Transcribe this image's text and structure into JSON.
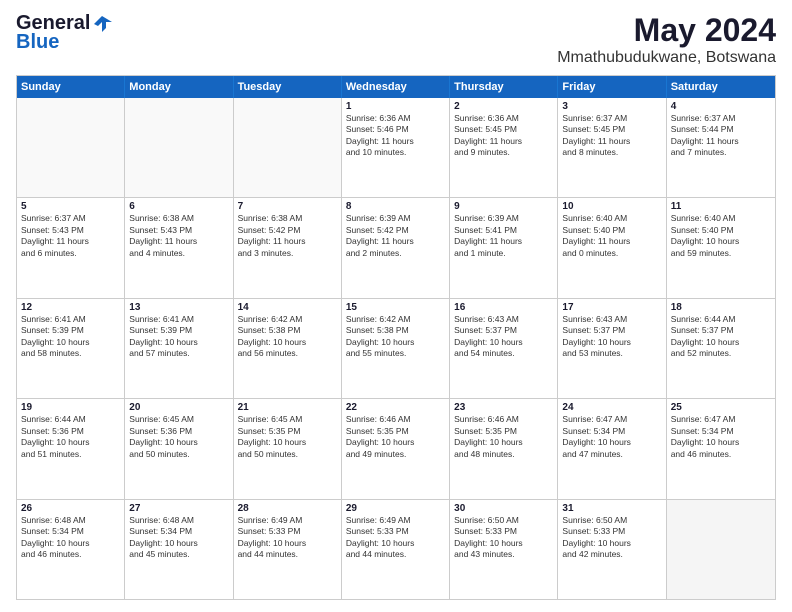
{
  "logo": {
    "line1": "General",
    "line2": "Blue"
  },
  "title": "May 2024",
  "subtitle": "Mmathubudukwane, Botswana",
  "weekdays": [
    "Sunday",
    "Monday",
    "Tuesday",
    "Wednesday",
    "Thursday",
    "Friday",
    "Saturday"
  ],
  "rows": [
    [
      {
        "day": "",
        "content": ""
      },
      {
        "day": "",
        "content": ""
      },
      {
        "day": "",
        "content": ""
      },
      {
        "day": "1",
        "content": "Sunrise: 6:36 AM\nSunset: 5:46 PM\nDaylight: 11 hours\nand 10 minutes."
      },
      {
        "day": "2",
        "content": "Sunrise: 6:36 AM\nSunset: 5:45 PM\nDaylight: 11 hours\nand 9 minutes."
      },
      {
        "day": "3",
        "content": "Sunrise: 6:37 AM\nSunset: 5:45 PM\nDaylight: 11 hours\nand 8 minutes."
      },
      {
        "day": "4",
        "content": "Sunrise: 6:37 AM\nSunset: 5:44 PM\nDaylight: 11 hours\nand 7 minutes."
      }
    ],
    [
      {
        "day": "5",
        "content": "Sunrise: 6:37 AM\nSunset: 5:43 PM\nDaylight: 11 hours\nand 6 minutes."
      },
      {
        "day": "6",
        "content": "Sunrise: 6:38 AM\nSunset: 5:43 PM\nDaylight: 11 hours\nand 4 minutes."
      },
      {
        "day": "7",
        "content": "Sunrise: 6:38 AM\nSunset: 5:42 PM\nDaylight: 11 hours\nand 3 minutes."
      },
      {
        "day": "8",
        "content": "Sunrise: 6:39 AM\nSunset: 5:42 PM\nDaylight: 11 hours\nand 2 minutes."
      },
      {
        "day": "9",
        "content": "Sunrise: 6:39 AM\nSunset: 5:41 PM\nDaylight: 11 hours\nand 1 minute."
      },
      {
        "day": "10",
        "content": "Sunrise: 6:40 AM\nSunset: 5:40 PM\nDaylight: 11 hours\nand 0 minutes."
      },
      {
        "day": "11",
        "content": "Sunrise: 6:40 AM\nSunset: 5:40 PM\nDaylight: 10 hours\nand 59 minutes."
      }
    ],
    [
      {
        "day": "12",
        "content": "Sunrise: 6:41 AM\nSunset: 5:39 PM\nDaylight: 10 hours\nand 58 minutes."
      },
      {
        "day": "13",
        "content": "Sunrise: 6:41 AM\nSunset: 5:39 PM\nDaylight: 10 hours\nand 57 minutes."
      },
      {
        "day": "14",
        "content": "Sunrise: 6:42 AM\nSunset: 5:38 PM\nDaylight: 10 hours\nand 56 minutes."
      },
      {
        "day": "15",
        "content": "Sunrise: 6:42 AM\nSunset: 5:38 PM\nDaylight: 10 hours\nand 55 minutes."
      },
      {
        "day": "16",
        "content": "Sunrise: 6:43 AM\nSunset: 5:37 PM\nDaylight: 10 hours\nand 54 minutes."
      },
      {
        "day": "17",
        "content": "Sunrise: 6:43 AM\nSunset: 5:37 PM\nDaylight: 10 hours\nand 53 minutes."
      },
      {
        "day": "18",
        "content": "Sunrise: 6:44 AM\nSunset: 5:37 PM\nDaylight: 10 hours\nand 52 minutes."
      }
    ],
    [
      {
        "day": "19",
        "content": "Sunrise: 6:44 AM\nSunset: 5:36 PM\nDaylight: 10 hours\nand 51 minutes."
      },
      {
        "day": "20",
        "content": "Sunrise: 6:45 AM\nSunset: 5:36 PM\nDaylight: 10 hours\nand 50 minutes."
      },
      {
        "day": "21",
        "content": "Sunrise: 6:45 AM\nSunset: 5:35 PM\nDaylight: 10 hours\nand 50 minutes."
      },
      {
        "day": "22",
        "content": "Sunrise: 6:46 AM\nSunset: 5:35 PM\nDaylight: 10 hours\nand 49 minutes."
      },
      {
        "day": "23",
        "content": "Sunrise: 6:46 AM\nSunset: 5:35 PM\nDaylight: 10 hours\nand 48 minutes."
      },
      {
        "day": "24",
        "content": "Sunrise: 6:47 AM\nSunset: 5:34 PM\nDaylight: 10 hours\nand 47 minutes."
      },
      {
        "day": "25",
        "content": "Sunrise: 6:47 AM\nSunset: 5:34 PM\nDaylight: 10 hours\nand 46 minutes."
      }
    ],
    [
      {
        "day": "26",
        "content": "Sunrise: 6:48 AM\nSunset: 5:34 PM\nDaylight: 10 hours\nand 46 minutes."
      },
      {
        "day": "27",
        "content": "Sunrise: 6:48 AM\nSunset: 5:34 PM\nDaylight: 10 hours\nand 45 minutes."
      },
      {
        "day": "28",
        "content": "Sunrise: 6:49 AM\nSunset: 5:33 PM\nDaylight: 10 hours\nand 44 minutes."
      },
      {
        "day": "29",
        "content": "Sunrise: 6:49 AM\nSunset: 5:33 PM\nDaylight: 10 hours\nand 44 minutes."
      },
      {
        "day": "30",
        "content": "Sunrise: 6:50 AM\nSunset: 5:33 PM\nDaylight: 10 hours\nand 43 minutes."
      },
      {
        "day": "31",
        "content": "Sunrise: 6:50 AM\nSunset: 5:33 PM\nDaylight: 10 hours\nand 42 minutes."
      },
      {
        "day": "",
        "content": ""
      }
    ]
  ]
}
